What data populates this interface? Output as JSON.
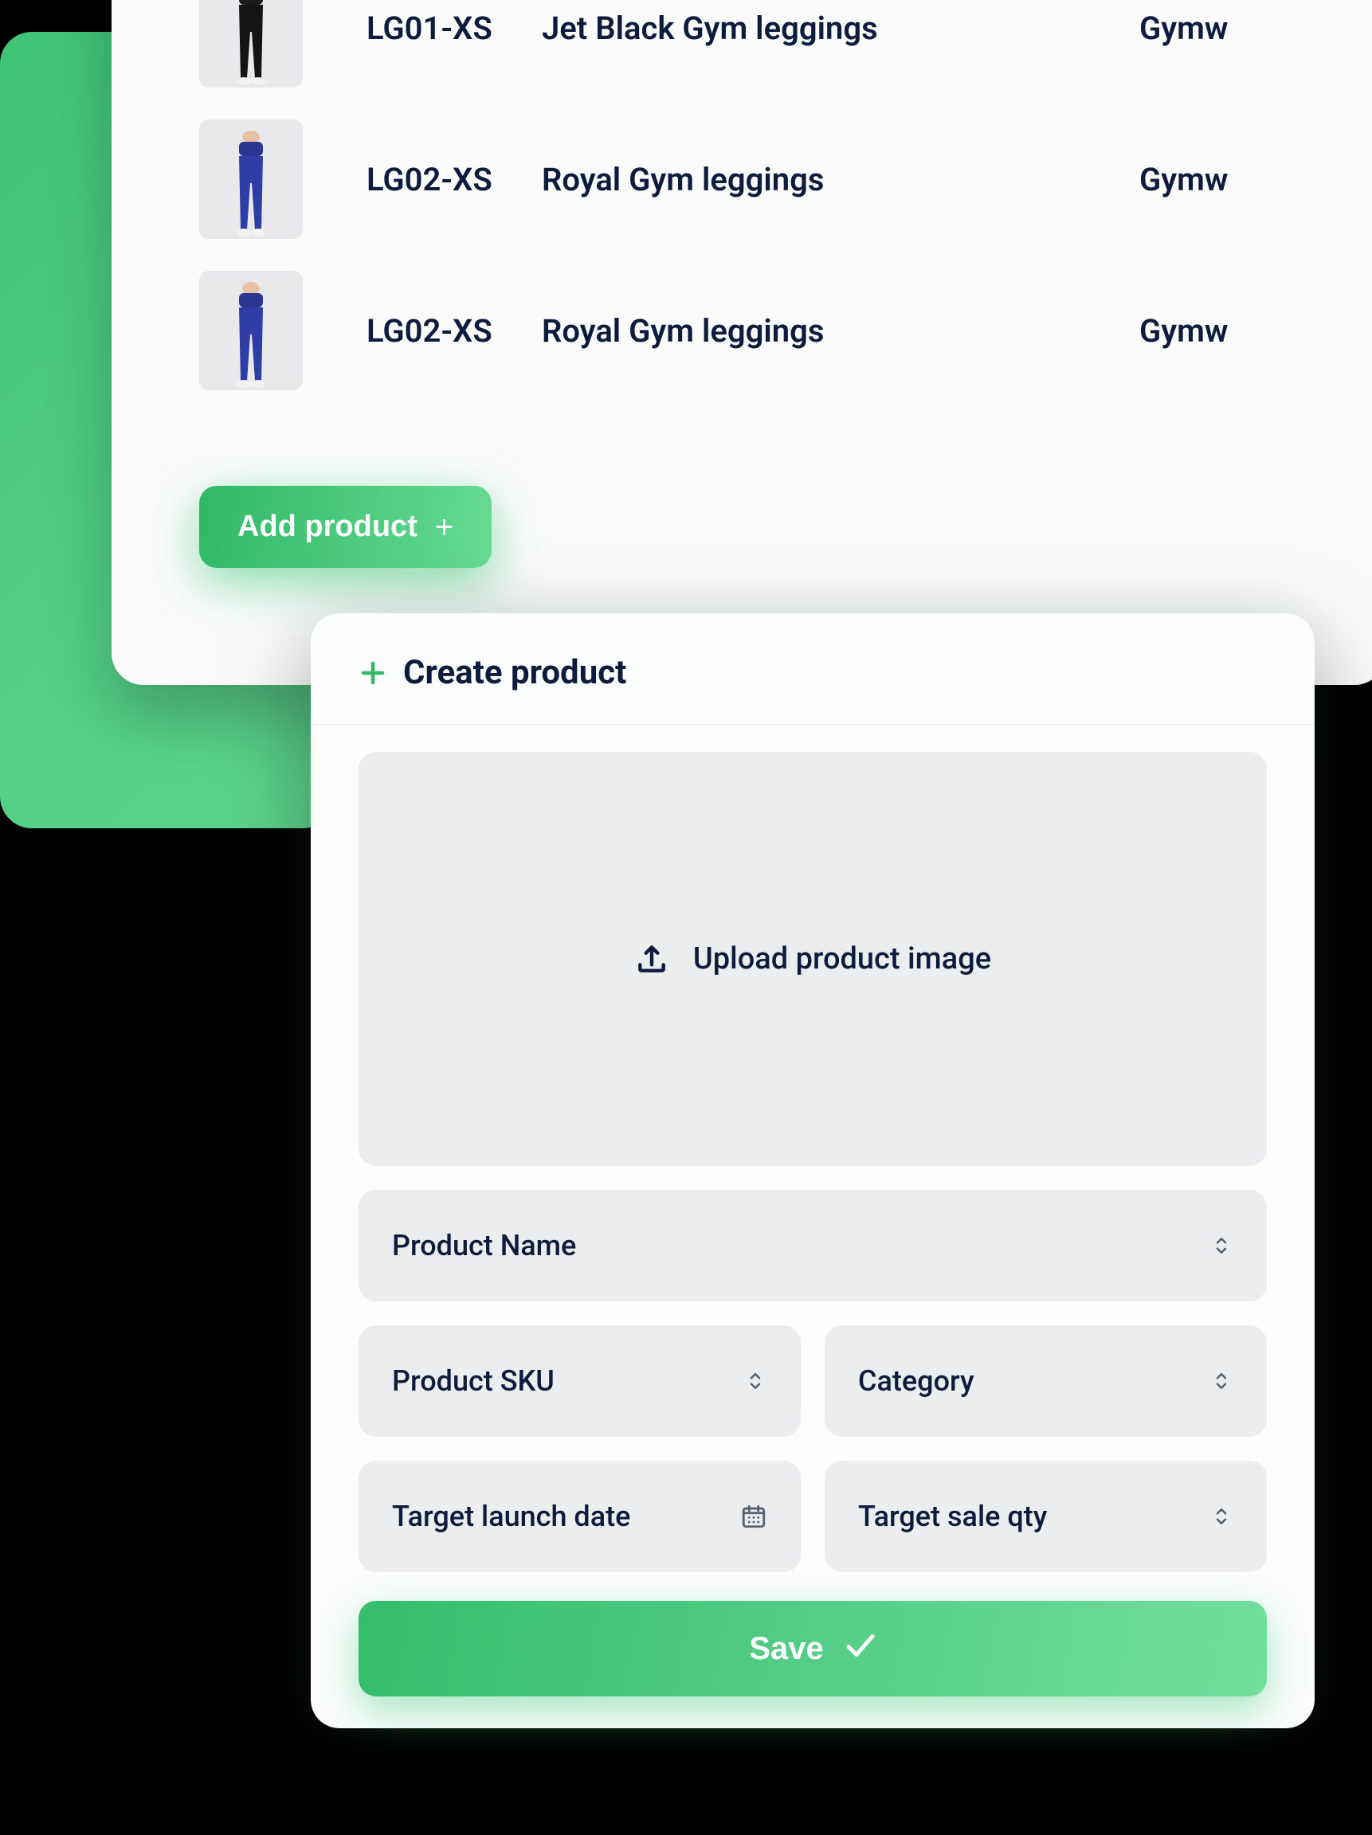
{
  "product_list": {
    "rows": [
      {
        "sku": "LG01-XS",
        "name": "Jet Black Gym leggings",
        "category": "Gymw",
        "color": "black"
      },
      {
        "sku": "LG02-XS",
        "name": "Royal Gym leggings",
        "category": "Gymw",
        "color": "navy"
      },
      {
        "sku": "LG02-XS",
        "name": "Royal Gym leggings",
        "category": "Gymw",
        "color": "navy"
      }
    ],
    "add_button": "Add product"
  },
  "create_modal": {
    "title": "Create product",
    "upload_label": "Upload product image",
    "fields": {
      "product_name": {
        "placeholder": "Product Name"
      },
      "product_sku": {
        "placeholder": "Product SKU"
      },
      "category": {
        "placeholder": "Category"
      },
      "launch_date": {
        "placeholder": "Target launch date"
      },
      "sale_qty": {
        "placeholder": "Target sale qty"
      }
    },
    "save_button": "Save"
  },
  "colors": {
    "accent": "#3fc377",
    "text": "#0d1b3d",
    "field_bg": "#ebedef"
  }
}
